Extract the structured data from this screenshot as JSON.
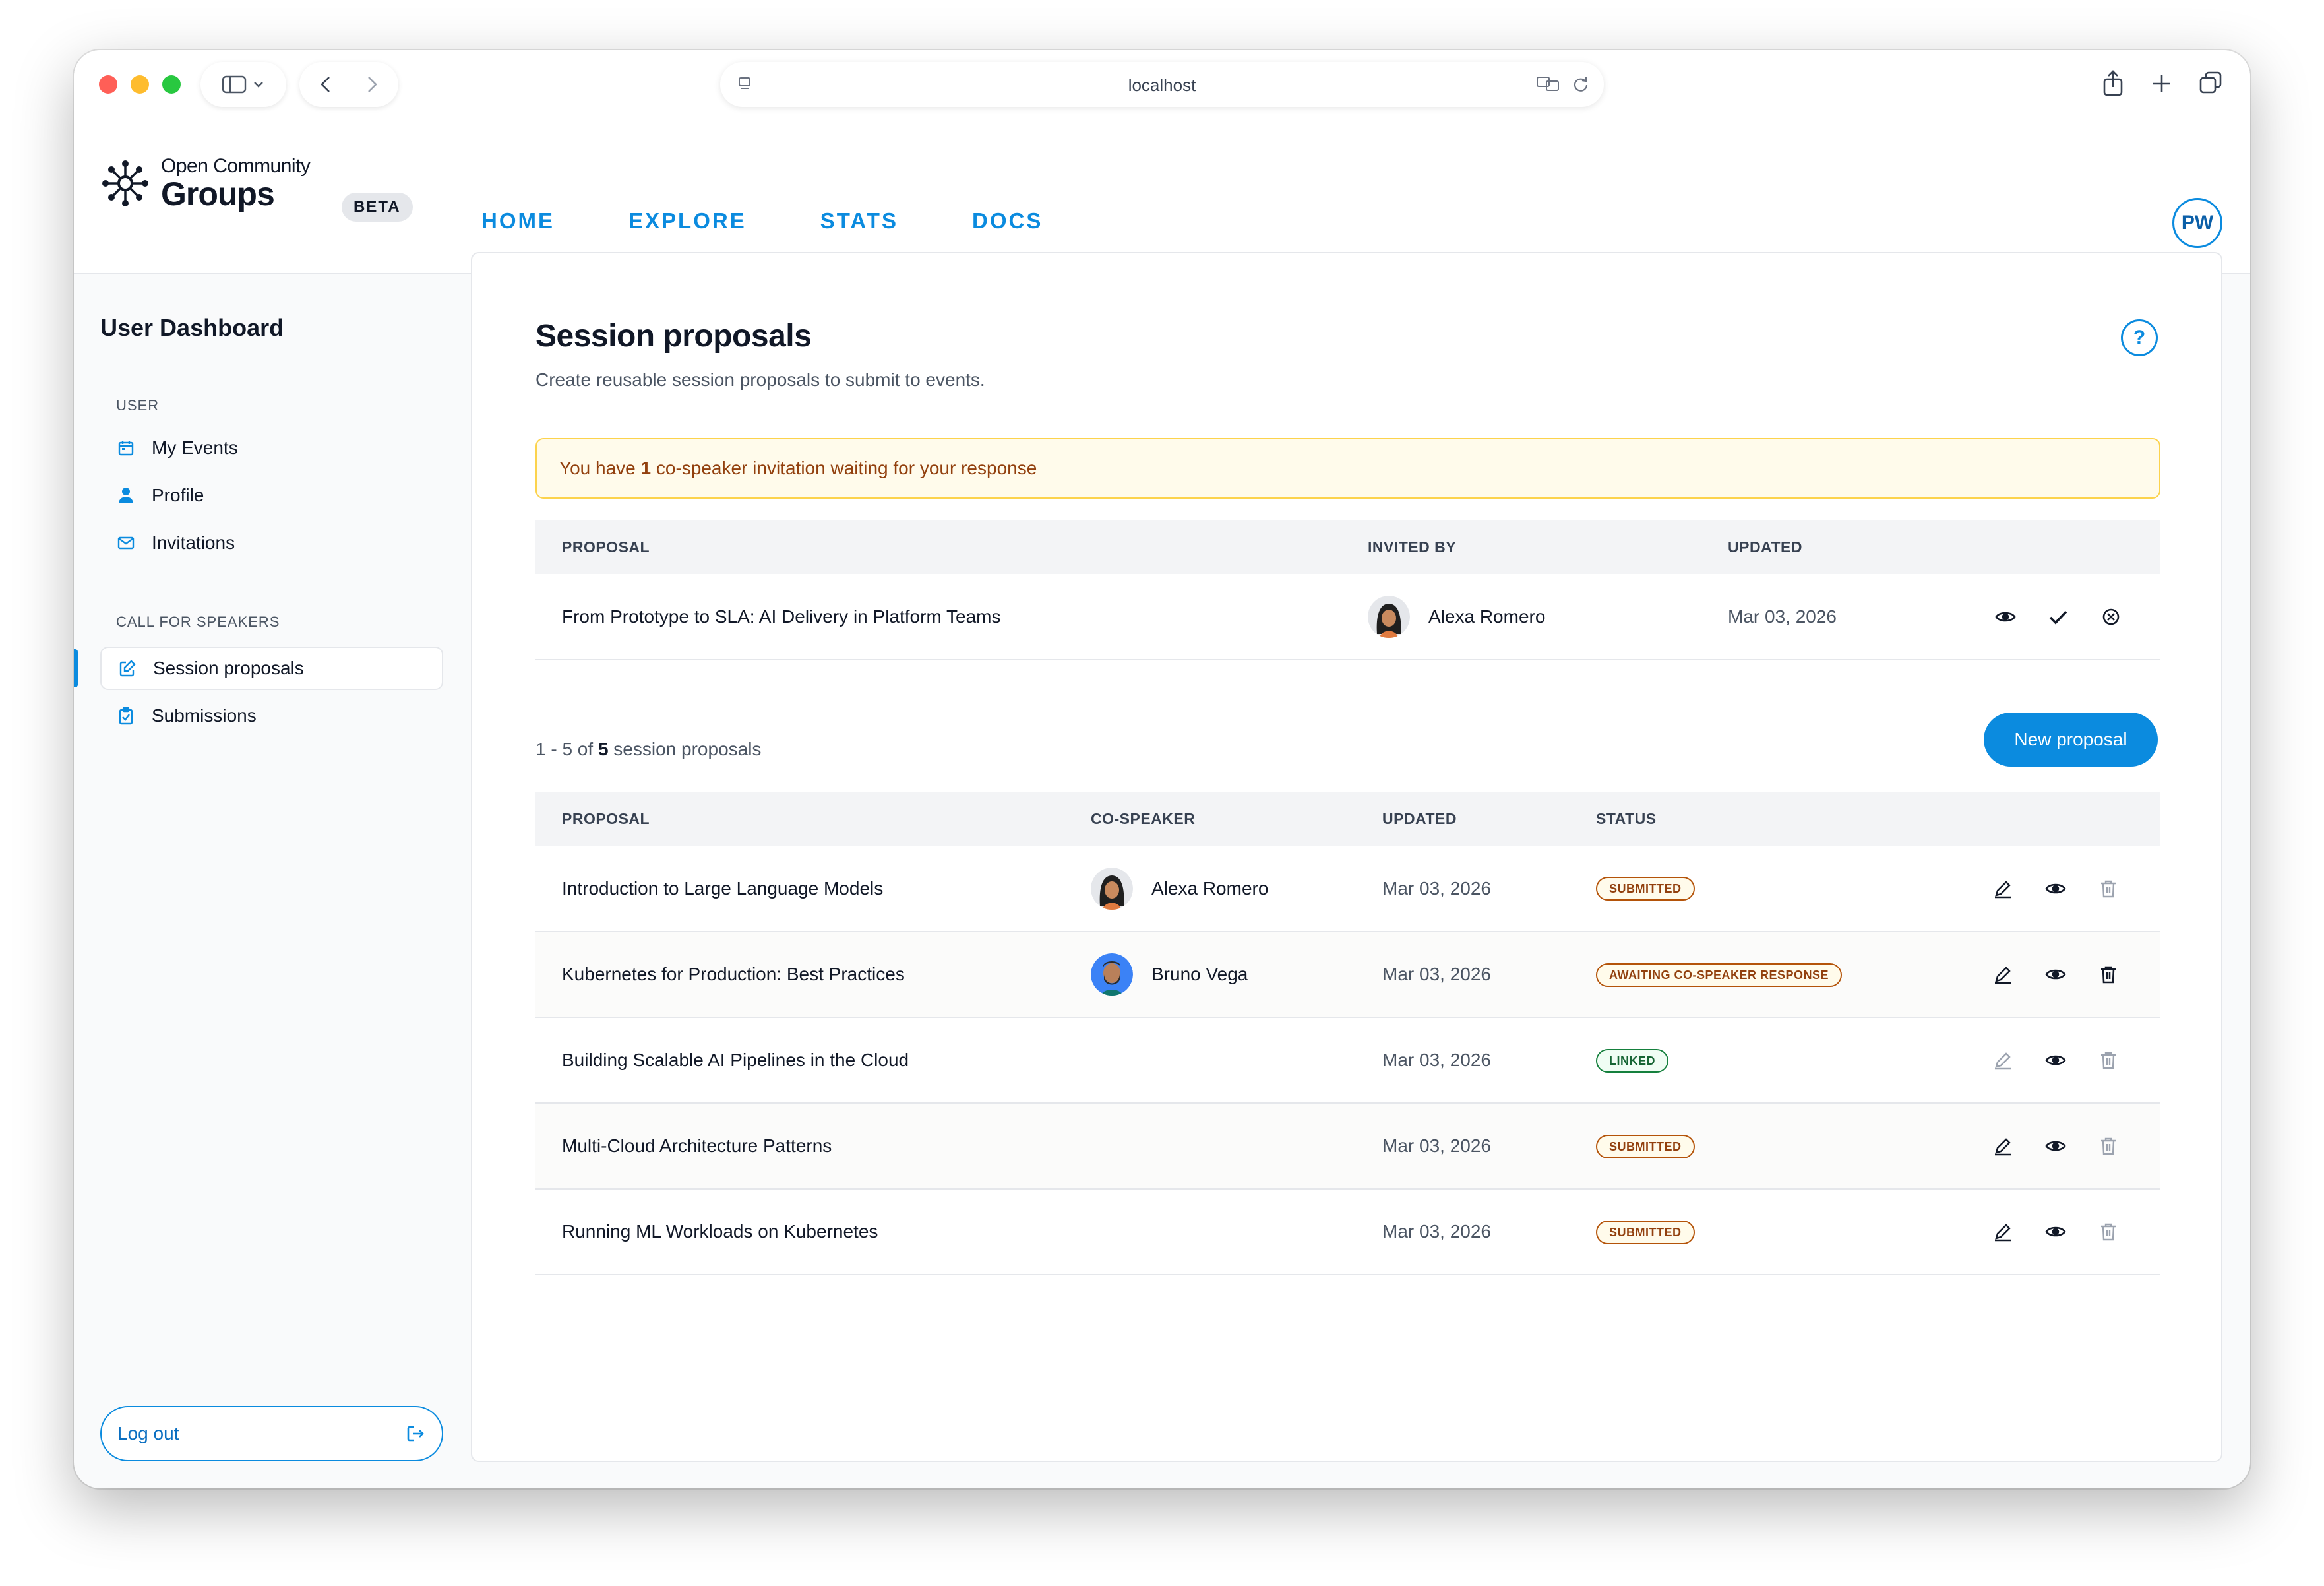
{
  "browser": {
    "url": "localhost"
  },
  "site": {
    "logo_line1": "Open Community",
    "logo_line2": "Groups",
    "beta_badge": "BETA",
    "nav": [
      "HOME",
      "EXPLORE",
      "STATS",
      "DOCS"
    ],
    "user_initials": "PW"
  },
  "sidebar": {
    "title": "User Dashboard",
    "user_section": "USER",
    "user_items": [
      {
        "label": "My Events",
        "icon": "calendar-icon"
      },
      {
        "label": "Profile",
        "icon": "user-icon"
      },
      {
        "label": "Invitations",
        "icon": "envelope-icon"
      }
    ],
    "cfs_section": "CALL FOR SPEAKERS",
    "cfs_items": [
      {
        "label": "Session proposals",
        "icon": "edit-document-icon",
        "active": true
      },
      {
        "label": "Submissions",
        "icon": "clipboard-check-icon",
        "active": false
      }
    ],
    "logout_label": "Log out"
  },
  "main": {
    "title": "Session proposals",
    "subtitle": "Create reusable session proposals to submit to events.",
    "help_label": "?",
    "notice": {
      "prefix": "You have ",
      "count": "1",
      "suffix": " co-speaker invitation waiting for your response"
    },
    "invitations_table": {
      "headers": [
        "PROPOSAL",
        "INVITED BY",
        "UPDATED"
      ],
      "rows": [
        {
          "proposal": "From Prototype to SLA: AI Delivery in Platform Teams",
          "invited_by": "Alexa Romero",
          "updated": "Mar 03, 2026"
        }
      ]
    },
    "count": {
      "range": "1 - 5",
      "of": " of ",
      "total": "5",
      "suffix": " session proposals"
    },
    "new_button": "New proposal",
    "proposals_table": {
      "headers": [
        "PROPOSAL",
        "CO-SPEAKER",
        "UPDATED",
        "STATUS"
      ],
      "rows": [
        {
          "proposal": "Introduction to Large Language Models",
          "co_speaker": "Alexa Romero",
          "updated": "Mar 03, 2026",
          "status": "SUBMITTED"
        },
        {
          "proposal": "Kubernetes for Production: Best Practices",
          "co_speaker": "Bruno Vega",
          "updated": "Mar 03, 2026",
          "status": "AWAITING CO-SPEAKER RESPONSE"
        },
        {
          "proposal": "Building Scalable AI Pipelines in the Cloud",
          "co_speaker": "",
          "updated": "Mar 03, 2026",
          "status": "LINKED"
        },
        {
          "proposal": "Multi-Cloud Architecture Patterns",
          "co_speaker": "",
          "updated": "Mar 03, 2026",
          "status": "SUBMITTED"
        },
        {
          "proposal": "Running ML Workloads on Kubernetes",
          "co_speaker": "",
          "updated": "Mar 03, 2026",
          "status": "SUBMITTED"
        }
      ]
    }
  },
  "colors": {
    "accent": "#0b8bdf",
    "warning_bg": "#fffbeb",
    "warning_border": "#fcd34d",
    "warning_text": "#92400e",
    "linked": "#15803d"
  }
}
